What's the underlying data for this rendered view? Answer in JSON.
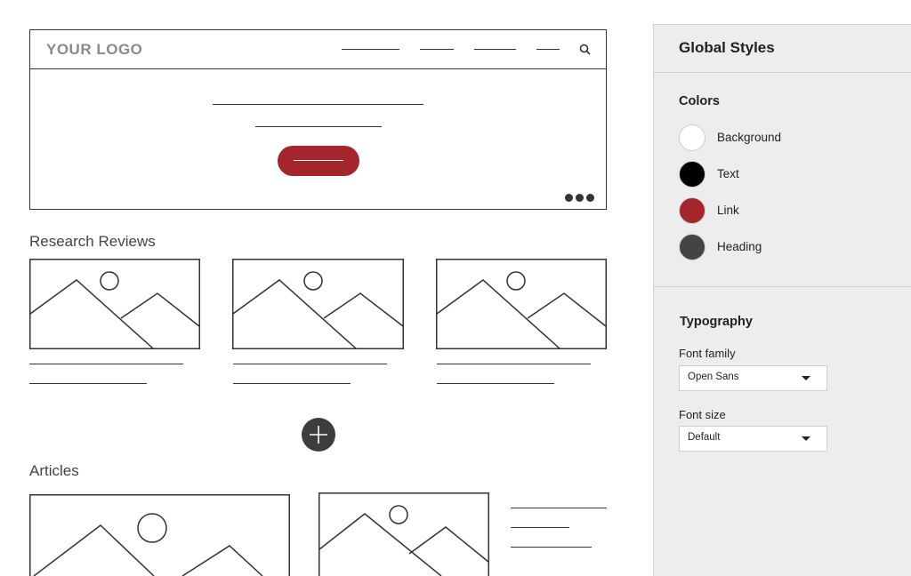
{
  "wireframe": {
    "logo_text": "YOUR LOGO",
    "sections": {
      "research_title": "Research Reviews",
      "articles_title": "Articles"
    },
    "accent_color": "#a4262c"
  },
  "panel": {
    "title": "Global Styles",
    "colors": {
      "title": "Colors",
      "items": [
        {
          "label": "Background",
          "color": "#ffffff"
        },
        {
          "label": "Text",
          "color": "#000000"
        },
        {
          "label": "Link",
          "color": "#a4262c"
        },
        {
          "label": "Heading",
          "color": "#444444"
        }
      ]
    },
    "typography": {
      "title": "Typography",
      "font_family_label": "Font family",
      "font_family_value": "Open Sans",
      "font_size_label": "Font size",
      "font_size_value": "Default"
    }
  },
  "icons": {
    "search": "search-icon",
    "more": "more-dots-icon",
    "add": "plus-icon",
    "image_placeholder": "image-placeholder-icon",
    "dropdown": "chevron-down-icon"
  }
}
